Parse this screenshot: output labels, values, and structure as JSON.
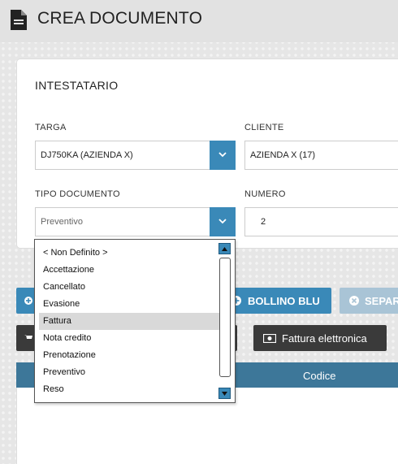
{
  "header": {
    "title": "CREA DOCUMENTO",
    "icon": "document-icon"
  },
  "panel": {
    "title": "INTESTATARIO",
    "targa": {
      "label": "TARGA",
      "value": "DJ750KA (AZIENDA X)"
    },
    "cliente": {
      "label": "CLIENTE",
      "value": "AZIENDA X (17)"
    },
    "tipo_documento": {
      "label": "TIPO DOCUMENTO",
      "value": "Preventivo"
    },
    "numero": {
      "label": "NUMERO",
      "value": "2"
    }
  },
  "toolbar": {
    "bollino_blu": "BOLLINO BLU",
    "separa": "SEPAR",
    "fattura_elettronica": "Fattura elettronica"
  },
  "table": {
    "columns": [
      "Codice"
    ]
  },
  "dropdown": {
    "options": [
      "< Non Definito >",
      "Accettazione",
      "Cancellato",
      "Evasione",
      "Fattura",
      "Nota credito",
      "Prenotazione",
      "Preventivo",
      "Reso"
    ],
    "highlighted": "Fattura"
  },
  "colors": {
    "accent": "#3a89b8",
    "table_header": "#3d7799",
    "dark_button": "#3a3a3a",
    "disabled_button": "#a9c4d6"
  }
}
